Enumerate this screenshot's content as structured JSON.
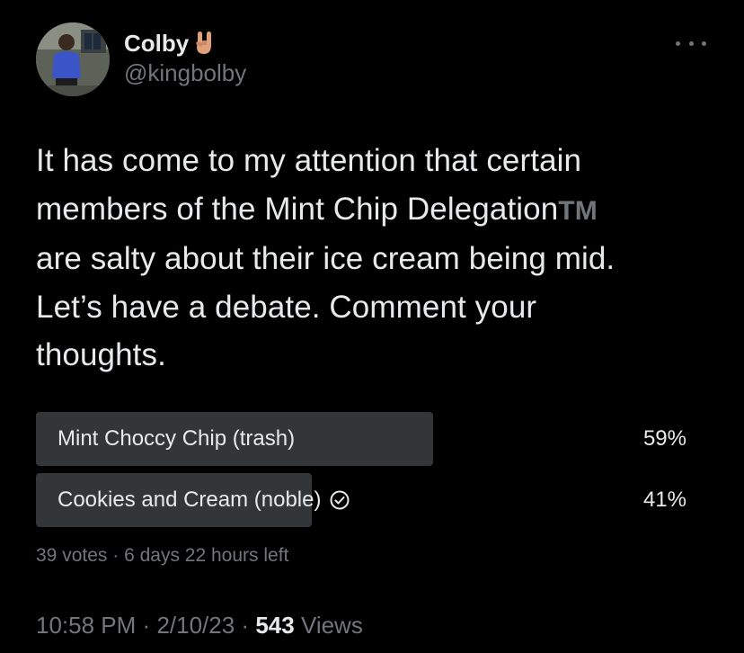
{
  "author": {
    "display_name": "Colby",
    "name_emoji": "sign-of-the-horns-emoji",
    "handle": "@kingbolby"
  },
  "tweet": {
    "lines": [
      "It has come to my attention that certain",
      "members of the Mint Chip Delegation",
      "are salty about their ice cream being mid.",
      "Let’s have a debate. Comment your",
      "thoughts."
    ],
    "trademark": "TM"
  },
  "poll": {
    "options": [
      {
        "label": "Mint Choccy Chip (trash)",
        "percent_text": "59%",
        "percent": 59,
        "selected": false
      },
      {
        "label": "Cookies and Cream (noble)",
        "percent_text": "41%",
        "percent": 41,
        "selected": true
      }
    ],
    "votes": "39 votes",
    "separator": "·",
    "time_left": "6 days 22 hours left"
  },
  "meta": {
    "time": "10:58 PM",
    "separator": "·",
    "date": "2/10/23",
    "views_count": "543",
    "views_label": "Views"
  },
  "colors": {
    "background": "#000000",
    "text_primary": "#e7e9ea",
    "text_secondary": "#71767b",
    "poll_bar": "#333639"
  },
  "icons": {
    "more": "more-horizontal-icon",
    "check": "check-circle-icon"
  }
}
